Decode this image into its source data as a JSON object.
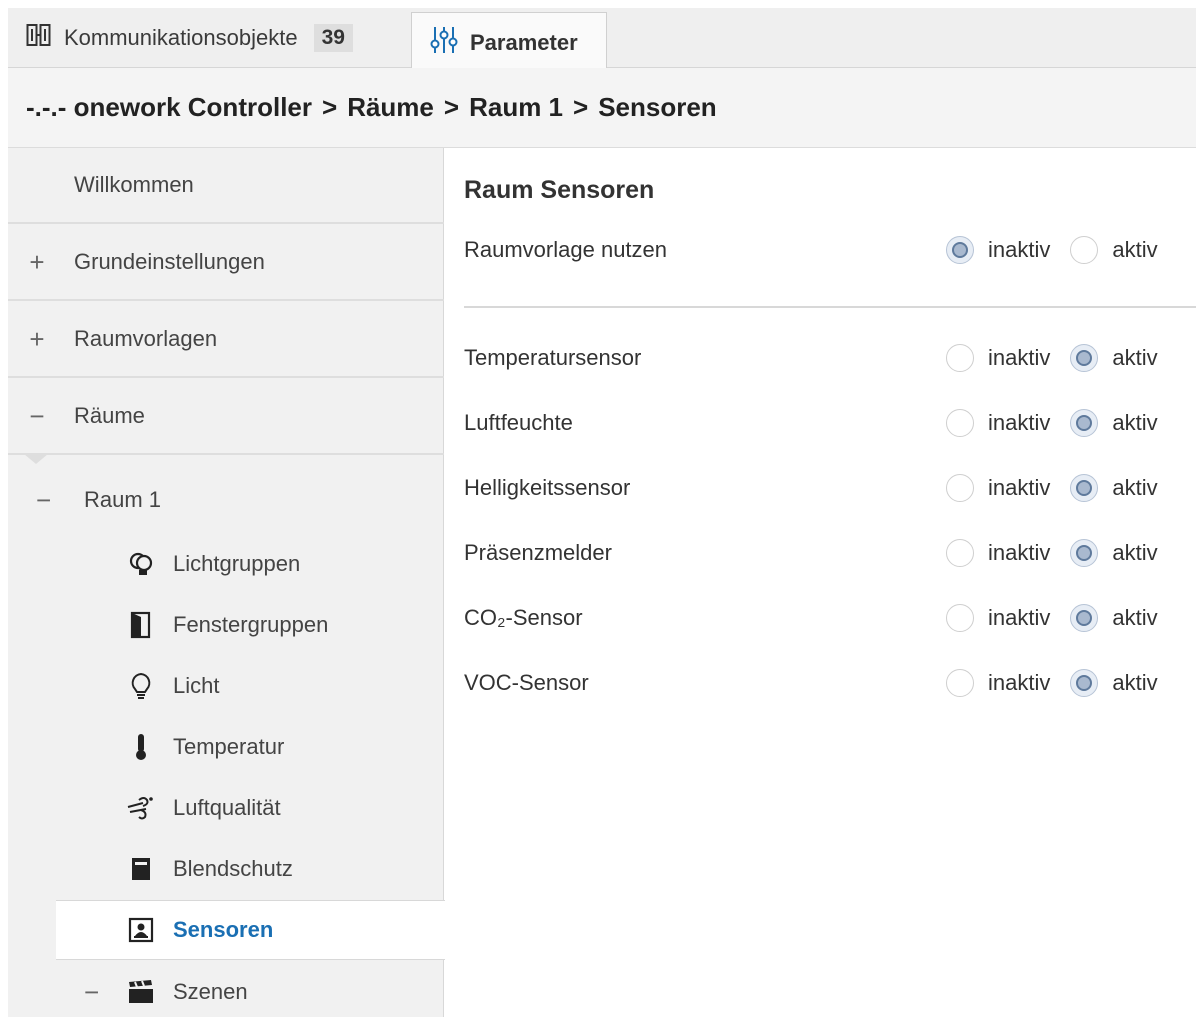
{
  "tabs": {
    "comm_label": "Kommunikationsobjekte",
    "comm_count": "39",
    "param_label": "Parameter"
  },
  "breadcrumb": [
    "-.-.- onework Controller",
    "Räume",
    "Raum 1",
    "Sensoren"
  ],
  "breadcrumb_sep": ">",
  "sidebar": {
    "top_items": [
      {
        "label": "Willkommen",
        "sign": ""
      },
      {
        "label": "Grundeinstellungen",
        "sign": "+"
      },
      {
        "label": "Raumvorlagen",
        "sign": "+"
      },
      {
        "label": "Räume",
        "sign": "−"
      }
    ],
    "room": {
      "label": "Raum 1",
      "sign": "−"
    },
    "room_items": [
      {
        "label": "Lichtgruppen",
        "icon": "bulb-group-icon"
      },
      {
        "label": "Fenstergruppen",
        "icon": "window-icon"
      },
      {
        "label": "Licht",
        "icon": "bulb-icon"
      },
      {
        "label": "Temperatur",
        "icon": "thermometer-icon"
      },
      {
        "label": "Luftqualität",
        "icon": "wind-icon"
      },
      {
        "label": "Blendschutz",
        "icon": "blind-icon"
      },
      {
        "label": "Sensoren",
        "icon": "sensor-icon",
        "selected": true
      }
    ],
    "scene": {
      "label": "Szenen",
      "sign": "−",
      "icon": "clapper-icon"
    }
  },
  "main": {
    "title": "Raum Sensoren",
    "template_row": {
      "label": "Raumvorlage nutzen",
      "value": "inaktiv"
    },
    "option_inactive": "inaktiv",
    "option_active": "aktiv",
    "sensors": [
      {
        "label": "Temperatursensor",
        "value": "aktiv"
      },
      {
        "label": "Luftfeuchte",
        "value": "aktiv"
      },
      {
        "label": "Helligkeitssensor",
        "value": "aktiv"
      },
      {
        "label": "Präsenzmelder",
        "value": "aktiv"
      },
      {
        "label": "CO₂-Sensor",
        "value": "aktiv"
      },
      {
        "label": "VOC-Sensor",
        "value": "aktiv"
      }
    ]
  },
  "colors": {
    "accent": "#1a6fb3",
    "radio_selected": "#5f7a9c"
  }
}
